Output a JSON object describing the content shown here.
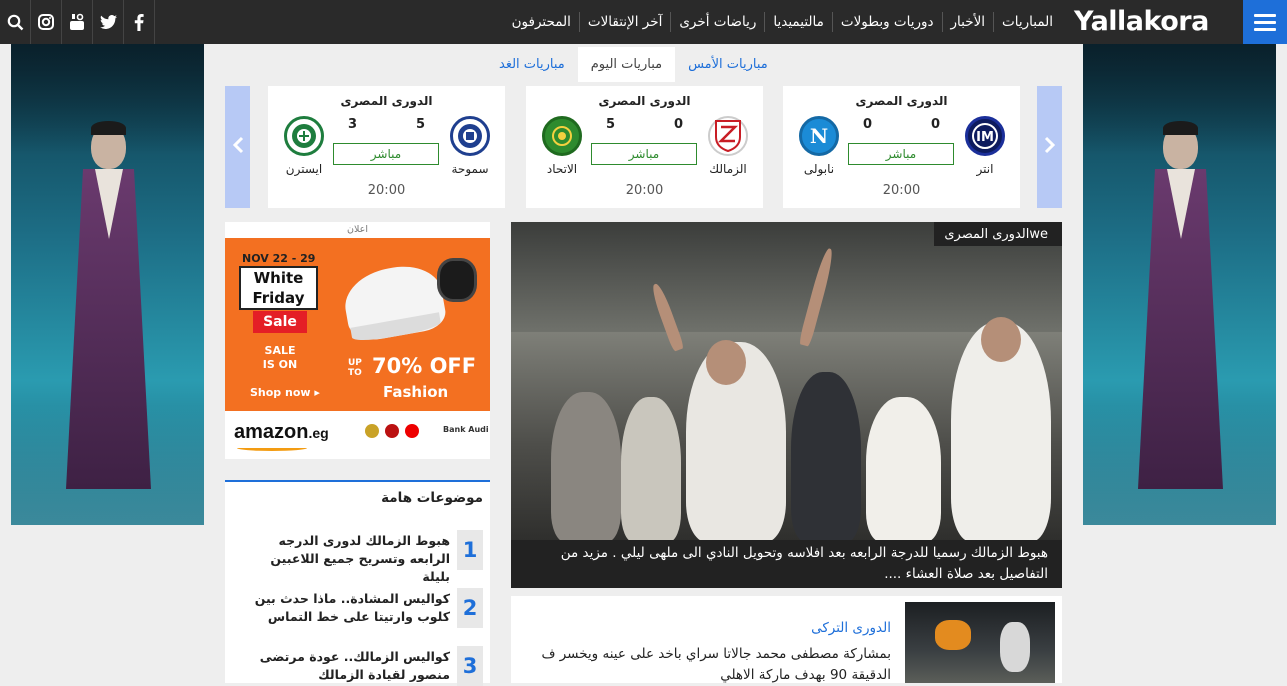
{
  "header": {
    "logo": "Yallakora",
    "nav": [
      "المباريات",
      "الأخبار",
      "دوريات وبطولات",
      "مالتيميديا",
      "رياضات أخرى",
      "آخر الإنتقالات",
      "المحترفون"
    ]
  },
  "colors": {
    "accent": "#1e6fd9",
    "topbar": "#2a2a2a",
    "live": "#2e8b2e",
    "ad": "#f37021"
  },
  "icons": [
    "menu-icon",
    "search-icon",
    "instagram-icon",
    "youtube-icon",
    "twitter-icon",
    "facebook-icon",
    "chevron-left-icon",
    "chevron-right-icon"
  ],
  "match_tabs": {
    "yesterday": "مباريات الأمس",
    "today": "مباريات اليوم",
    "tomorrow": "مباريات الغد"
  },
  "matches": [
    {
      "league": "الدورى المصرى",
      "home": "انتر",
      "away": "نابولى",
      "home_score": "0",
      "away_score": "0",
      "status": "مباشر",
      "time": "20:00"
    },
    {
      "league": "الدورى المصرى",
      "home": "الزمالك",
      "away": "الاتحاد",
      "home_score": "0",
      "away_score": "5",
      "status": "مباشر",
      "time": "20:00"
    },
    {
      "league": "الدورى المصرى",
      "home": "سموحة",
      "away": "ايسترن",
      "home_score": "5",
      "away_score": "3",
      "status": "مباشر",
      "time": "20:00"
    }
  ],
  "ad": {
    "label": "اعلان",
    "dates": "NOV 22 - 29",
    "white_friday": "White Friday",
    "sale": "Sale",
    "sale_is_on": "SALE IS ON",
    "shop_now": "Shop now ▸",
    "up_to": "UP TO",
    "off": "70% OFF",
    "fashion": "Fashion",
    "amazon": "amazon",
    "amazon_tld": ".eg",
    "bank": "Bank Audi"
  },
  "topics": {
    "title": "موضوعات هامة",
    "items": [
      {
        "num": "1",
        "text": "هبوط الزمالك لدورى الدرجه الرابعه وتسريح جميع اللاعبين بليلة"
      },
      {
        "num": "2",
        "text": "كواليس المشادة.. ماذا حدث بين كلوب وارتيتا على خط التماس"
      },
      {
        "num": "3",
        "text": "كواليس الزمالك.. عودة مرتضى منصور لقيادة الزمالك"
      }
    ]
  },
  "hero": {
    "badge": "الدورى المصرىwe",
    "caption": "هبوط الزمالك رسميا للدرجة الرابعه بعد افلاسه وتحويل النادي الى ملهى ليلي . مزيد من التفاصيل بعد صلاة العشاء ...."
  },
  "story2": {
    "tag": "الدورى التركى",
    "text": "بمشاركة مصطفى محمد جالاتا سراي باخد على عينه ويخسر ف الدقيقة 90 بهدف ماركة الاهلي"
  }
}
